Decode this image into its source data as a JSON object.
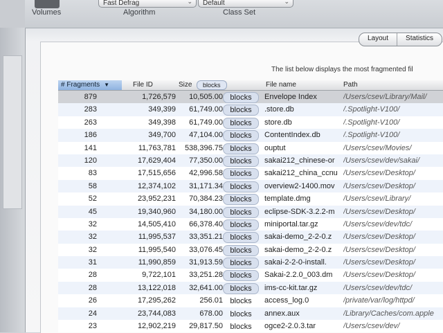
{
  "toolbar": {
    "volumes_label": "Volumes",
    "algorithm_label": "Algorithm",
    "algorithm_value": "Fast Defrag",
    "classset_label": "Class Set",
    "classset_value": "Default"
  },
  "segments": [
    "Layout",
    "Statistics"
  ],
  "info_text": "The list below displays the most fragmented fil",
  "columns": {
    "fragments": "# Fragments",
    "file_id": "File ID",
    "size": "Size",
    "size_unit": "blocks",
    "file_name": "File name",
    "path": "Path"
  },
  "rows": [
    {
      "fragments": "879",
      "file_id": "1,726,579",
      "size": "10,505.00",
      "unit": "blocks",
      "name": "Envelope Index",
      "path": "/Users/csev/Library/Mail/"
    },
    {
      "fragments": "283",
      "file_id": "349,399",
      "size": "61,749.00",
      "unit": "blocks",
      "name": ".store.db",
      "path": "/.Spotlight-V100/"
    },
    {
      "fragments": "263",
      "file_id": "349,398",
      "size": "61,749.00",
      "unit": "blocks",
      "name": "store.db",
      "path": "/.Spotlight-V100/"
    },
    {
      "fragments": "186",
      "file_id": "349,700",
      "size": "47,104.00",
      "unit": "blocks",
      "name": "ContentIndex.db",
      "path": "/.Spotlight-V100/"
    },
    {
      "fragments": "141",
      "file_id": "11,763,781",
      "size": "538,396.75",
      "unit": "blocks",
      "name": "ouptut",
      "path": "/Users/csev/Movies/"
    },
    {
      "fragments": "120",
      "file_id": "17,629,404",
      "size": "77,350.00",
      "unit": "blocks",
      "name": "sakai212_chinese-or",
      "path": "/Users/csev/dev/sakai/"
    },
    {
      "fragments": "83",
      "file_id": "17,515,656",
      "size": "42,996.58",
      "unit": "blocks",
      "name": "sakai212_china_ccnu",
      "path": "/Users/csev/Desktop/"
    },
    {
      "fragments": "58",
      "file_id": "12,374,102",
      "size": "31,171.34",
      "unit": "blocks",
      "name": "overview2-1400.mov",
      "path": "/Users/csev/Desktop/"
    },
    {
      "fragments": "52",
      "file_id": "23,952,231",
      "size": "70,384.23",
      "unit": "blocks",
      "name": "template.dmg",
      "path": "/Users/csev/Library/"
    },
    {
      "fragments": "45",
      "file_id": "19,340,960",
      "size": "34,180.00",
      "unit": "blocks",
      "name": "eclipse-SDK-3.2.2-m",
      "path": "/Users/csev/Desktop/"
    },
    {
      "fragments": "32",
      "file_id": "14,505,410",
      "size": "66,378.40",
      "unit": "blocks",
      "name": "miniportal.tar.gz",
      "path": "/Users/csev/dev/tdc/"
    },
    {
      "fragments": "32",
      "file_id": "11,995,537",
      "size": "33,351.21",
      "unit": "blocks",
      "name": "sakai-demo_2-2-0.z",
      "path": "/Users/csev/Desktop/"
    },
    {
      "fragments": "32",
      "file_id": "11,995,540",
      "size": "33,076.45",
      "unit": "blocks",
      "name": "sakai-demo_2-2-0.z",
      "path": "/Users/csev/Desktop/"
    },
    {
      "fragments": "31",
      "file_id": "11,990,859",
      "size": "31,913.59",
      "unit": "blocks",
      "name": "sakai-2-2-0-install.",
      "path": "/Users/csev/Desktop/"
    },
    {
      "fragments": "28",
      "file_id": "9,722,101",
      "size": "33,251.28",
      "unit": "blocks",
      "name": "Sakai-2.2.0_003.dm",
      "path": "/Users/csev/Desktop/"
    },
    {
      "fragments": "28",
      "file_id": "13,122,018",
      "size": "32,641.00",
      "unit": "blocks",
      "name": "ims-cc-kit.tar.gz",
      "path": "/Users/csev/dev/tdc/"
    },
    {
      "fragments": "26",
      "file_id": "17,295,262",
      "size": "256.01",
      "unit": "blocks",
      "name": "access_log.0",
      "path": "/private/var/log/httpd/"
    },
    {
      "fragments": "24",
      "file_id": "23,744,083",
      "size": "678.00",
      "unit": "blocks",
      "name": "annex.aux",
      "path": "/Library/Caches/com.apple"
    },
    {
      "fragments": "23",
      "file_id": "12,902,219",
      "size": "29,817.50",
      "unit": "blocks",
      "name": "ogce2-2.0.3.tar",
      "path": "/Users/csev/dev/"
    }
  ]
}
